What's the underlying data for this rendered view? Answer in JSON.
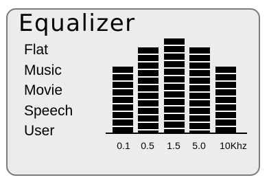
{
  "equalizer": {
    "title": "Equalizer",
    "presets": [
      {
        "label": "Flat"
      },
      {
        "label": "Music"
      },
      {
        "label": "Movie"
      },
      {
        "label": "Speech"
      },
      {
        "label": "User"
      }
    ],
    "bands": [
      {
        "label": "0.1",
        "level": 0.67
      },
      {
        "label": "0.5",
        "level": 0.86
      },
      {
        "label": "1.5",
        "level": 0.95
      },
      {
        "label": "5.0",
        "level": 0.86
      },
      {
        "label": "10Khz",
        "level": 0.67
      }
    ],
    "colors": {
      "panel_background": "#ececec",
      "panel_border": "#7a7a7a",
      "bar": "#000000",
      "bar_separator": "#ffffff"
    }
  }
}
